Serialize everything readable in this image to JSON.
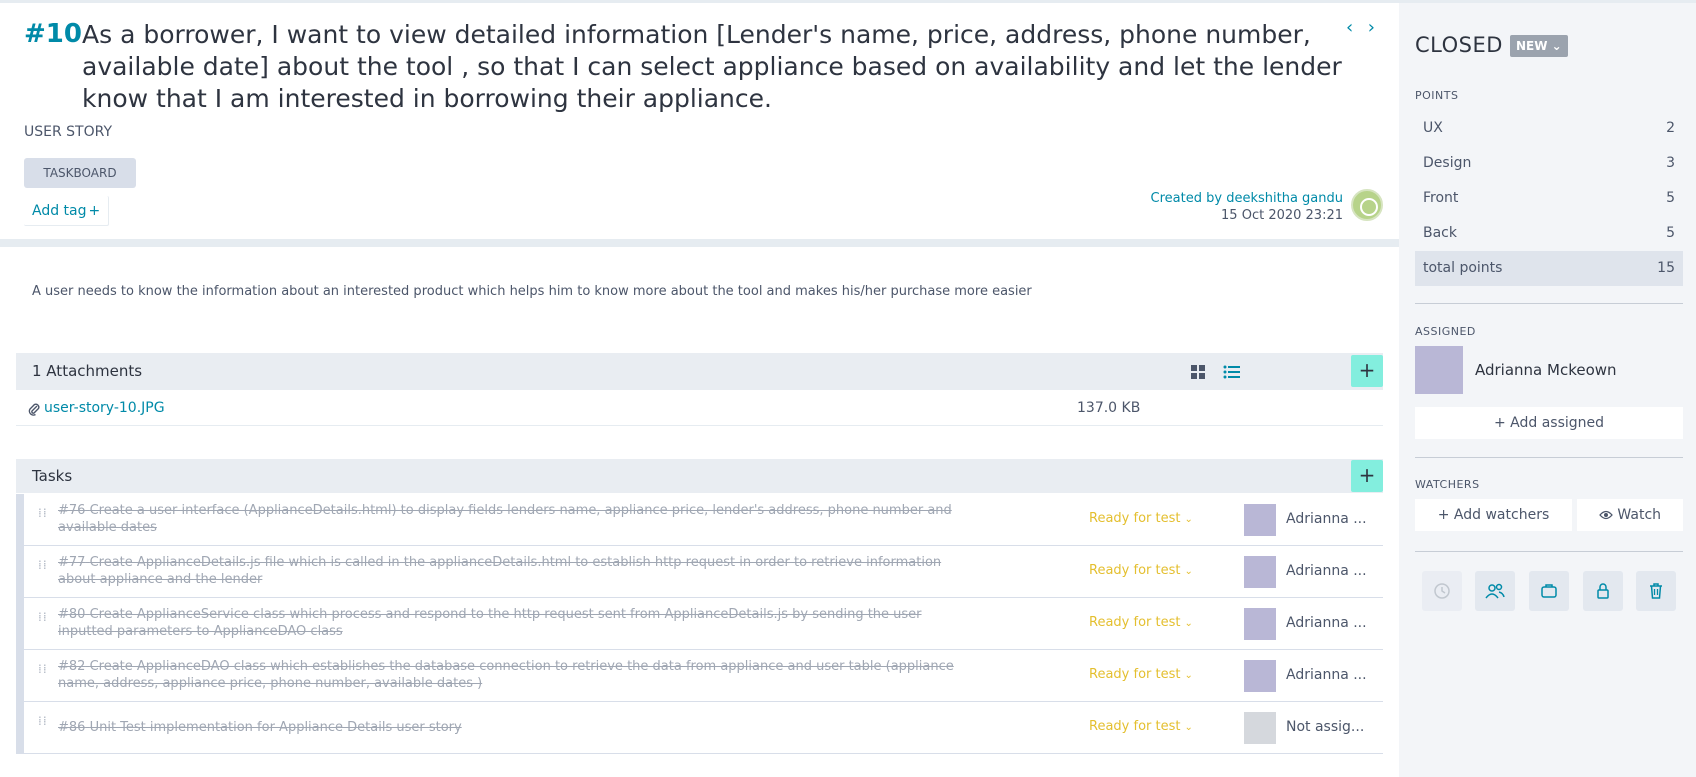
{
  "story": {
    "id": "#10",
    "title": "As a borrower, I want to view detailed information [Lender's name, price, address, phone number, available date] about the tool , so that I can select appliance based on availability and let the lender know that I am interested in borrowing their appliance.",
    "type": "USER STORY",
    "epic_tag": "TASKBOARD",
    "add_tag": "Add tag",
    "created_by": "Created by deekshitha gandu",
    "created_date": "15 Oct 2020 23:21",
    "description": "A user needs to know the information about an interested product which helps him to know more about the tool and makes his/her purchase more easier"
  },
  "nav": {
    "prev": "‹",
    "next": "›"
  },
  "attachments": {
    "header": "1 Attachments",
    "items": [
      {
        "name": "user-story-10.JPG",
        "size": "137.0 KB"
      }
    ]
  },
  "tasks": {
    "header": "Tasks",
    "items": [
      {
        "ref": "#76",
        "text": "Create a user interface (ApplianceDetails.html) to display fields lenders name, appliance price, lender's address, phone number and available dates",
        "status": "Ready for test",
        "assignee": "Adrianna ..."
      },
      {
        "ref": "#77",
        "text": "Create ApplianceDetails.js file which is called in the applianceDetails.html to establish http request in order to retrieve information about appliance and the lender",
        "status": "Ready for test",
        "assignee": "Adrianna ..."
      },
      {
        "ref": "#80",
        "text": "Create ApplianceService class which process and respond to the http request sent from ApplianceDetails.js by sending the user inputted parameters to ApplianceDAO class",
        "status": "Ready for test",
        "assignee": "Adrianna ..."
      },
      {
        "ref": "#82",
        "text": "Create ApplianceDAO class which establishes the database connection to retrieve the data from appliance and user table (appliance name, address, appliance price, phone number, available dates )",
        "status": "Ready for test",
        "assignee": "Adrianna ..."
      },
      {
        "ref": "#86",
        "text": "Unit Test implementation for Appliance Details user story",
        "status": "Ready for test",
        "assignee": "Not assig..."
      }
    ]
  },
  "sidebar": {
    "status": "CLOSED",
    "status_badge": "NEW",
    "points_label": "POINTS",
    "points": [
      {
        "name": "UX",
        "value": "2"
      },
      {
        "name": "Design",
        "value": "3"
      },
      {
        "name": "Front",
        "value": "5"
      },
      {
        "name": "Back",
        "value": "5"
      },
      {
        "name": "total points",
        "value": "15"
      }
    ],
    "assigned_label": "ASSIGNED",
    "assigned_name": "Adrianna Mckeown",
    "add_assigned": "+ Add assigned",
    "watchers_label": "WATCHERS",
    "add_watchers": "+ Add watchers",
    "watch": "Watch"
  },
  "colors": {
    "accent": "#008aa8",
    "add_button": "#83eede",
    "status_ready": "#e4bf2f",
    "sidebar_bg": "#f3f5f8"
  },
  "icons": [
    "chevron-left-icon",
    "chevron-right-icon",
    "grid-view-icon",
    "list-view-icon",
    "plus-icon",
    "paperclip-icon",
    "drag-handle-icon",
    "chevron-down-icon",
    "eye-icon",
    "clock-icon",
    "team-icon",
    "block-icon",
    "lock-icon",
    "trash-icon"
  ]
}
